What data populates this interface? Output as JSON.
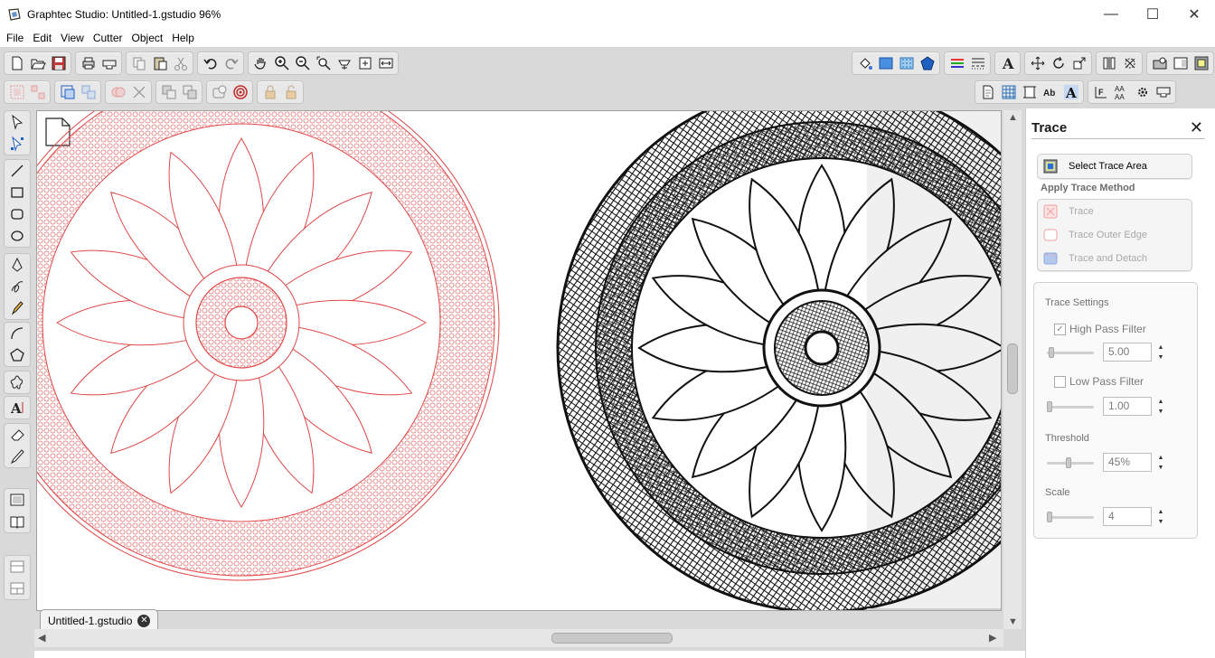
{
  "window": {
    "title": "Graphtec Studio: Untitled-1.gstudio 96%",
    "minimize_label": "—",
    "maximize_label": "☐",
    "close_label": "✕"
  },
  "menu": [
    "File",
    "Edit",
    "View",
    "Cutter",
    "Object",
    "Help"
  ],
  "toolbar": {
    "row1_left": [
      "new-doc-icon",
      "open-icon",
      "save-icon",
      "print-icon",
      "send-to-cutter-icon",
      "copy-icon",
      "paste-icon",
      "cut-icon",
      "undo-icon",
      "redo-icon",
      "pan-hand-icon",
      "zoom-in-icon",
      "zoom-out-icon",
      "zoom-area-icon",
      "zoom-page-icon",
      "fit-selection-icon",
      "fit-width-icon"
    ],
    "row1_right": [
      "fill-bucket-icon",
      "panel-color-icon",
      "panel-pattern-icon",
      "shape-fill-icon",
      "line-color-icon",
      "line-style-icon",
      "text-icon",
      "transform-move-icon",
      "rotate-icon",
      "scale-icon",
      "align-icon",
      "replicate-icon",
      "print-and-cut-icon",
      "page-setup-icon",
      "trace-icon"
    ],
    "row2_left": [
      "group-icon",
      "ungroup-icon",
      "compound-icon",
      "release-compound-icon",
      "weld-icon",
      "subtract-icon",
      "send-back-icon",
      "bring-front-icon",
      "offset-icon",
      "target-icon",
      "lock-icon",
      "unlock-icon"
    ],
    "row2_right": [
      "page-icon",
      "grid-icon",
      "crop-marks-icon",
      "text-style-icon",
      "font-icon",
      "position-icon",
      "text-size-icon",
      "settings-icon",
      "send-icon"
    ]
  },
  "left_tools": [
    "select-arrow-icon",
    "edit-points-icon",
    "line-tool-icon",
    "rectangle-tool-icon",
    "rounded-rect-tool-icon",
    "ellipse-tool-icon",
    "pen-tool-icon",
    "freehand-icon",
    "pencil-icon",
    "arc-tool-icon",
    "polygon-tool-icon",
    "star-tool-icon",
    "text-tool-icon",
    "eraser-icon",
    "knife-icon",
    "layer-view-icon",
    "library-icon",
    "split-view-top-icon",
    "split-view-bottom-icon"
  ],
  "document_tab": {
    "label": "Untitled-1.gstudio",
    "close_label": "✕"
  },
  "trace_panel": {
    "title": "Trace",
    "close_label": "✕",
    "select_area_label": "Select Trace Area",
    "apply_method_heading": "Apply Trace Method",
    "methods": [
      "Trace",
      "Trace Outer Edge",
      "Trace and Detach"
    ],
    "settings_heading": "Trace Settings",
    "high_pass": {
      "label": "High Pass Filter",
      "checked": true,
      "value": "5.00"
    },
    "low_pass": {
      "label": "Low Pass Filter",
      "checked": false,
      "value": "1.00"
    },
    "threshold": {
      "label": "Threshold",
      "value": "45%"
    },
    "scale": {
      "label": "Scale",
      "value": "4"
    }
  },
  "colors": {
    "trace_red": "#e04848",
    "chrome": "#d9d9d9",
    "panel_border": "#cfcfcf"
  }
}
